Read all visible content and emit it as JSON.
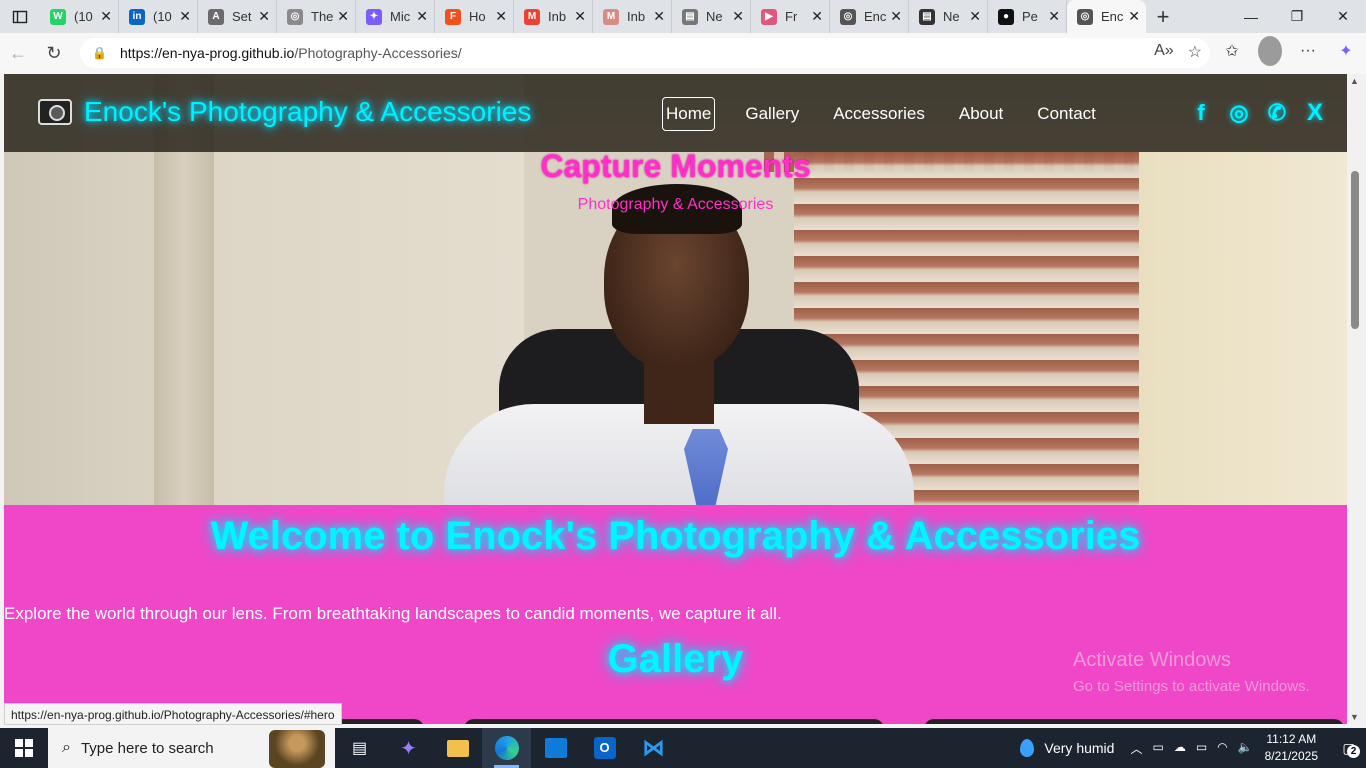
{
  "browser": {
    "tabs": [
      {
        "title": "(10",
        "icon": "whatsapp-icon",
        "color": "#25d366",
        "glyph": "W"
      },
      {
        "title": "(10",
        "icon": "linkedin-icon",
        "color": "#0a66c2",
        "glyph": "in"
      },
      {
        "title": "Set",
        "icon": "settings-icon",
        "color": "#6b6b6b",
        "glyph": "A"
      },
      {
        "title": "The",
        "icon": "globe-icon",
        "color": "#8a8a8a",
        "glyph": "◎"
      },
      {
        "title": "Mic",
        "icon": "copilot-icon",
        "color": "#7a5cff",
        "glyph": "✦"
      },
      {
        "title": "Ho",
        "icon": "figma-icon",
        "color": "#f24e1e",
        "glyph": "F"
      },
      {
        "title": "Inb",
        "icon": "gmail-icon",
        "color": "#ea4335",
        "glyph": "M"
      },
      {
        "title": "Inb",
        "icon": "gmail-icon",
        "color": "#d68b84",
        "glyph": "M"
      },
      {
        "title": "Ne",
        "icon": "news-icon",
        "color": "#777777",
        "glyph": "▤"
      },
      {
        "title": "Fr",
        "icon": "youtube-icon",
        "color": "#e0567d",
        "glyph": "▶"
      },
      {
        "title": "Enc",
        "icon": "globe-icon",
        "color": "#555555",
        "glyph": "◎"
      },
      {
        "title": "Ne",
        "icon": "news-icon",
        "color": "#333333",
        "glyph": "▤"
      },
      {
        "title": "Pe",
        "icon": "github-icon",
        "color": "#111111",
        "glyph": "●"
      },
      {
        "title": "Enc",
        "icon": "globe-icon",
        "color": "#555555",
        "glyph": "◎"
      }
    ],
    "url_host": "https://en-nya-prog.github.io",
    "url_path": "/Photography-Accessories/",
    "status_url": "https://en-nya-prog.github.io/Photography-Accessories/#hero"
  },
  "site": {
    "brand": "Enock's Photography & Accessories",
    "nav": [
      "Home",
      "Gallery",
      "Accessories",
      "About",
      "Contact"
    ],
    "social": [
      "f",
      "◎",
      "✆",
      "X"
    ],
    "hero_title": "Capture Moments",
    "hero_subtitle": "Photography & Accessories",
    "welcome_heading": "Welcome to Enock's Photography & Accessories",
    "intro": "Explore the world through our lens. From breathtaking landscapes to candid moments, we capture it all.",
    "gallery_heading": "Gallery"
  },
  "watermark": {
    "line1": "Activate Windows",
    "line2": "Go to Settings to activate Windows."
  },
  "taskbar": {
    "search_placeholder": "Type here to search",
    "weather": "Very humid",
    "time": "11:12 AM",
    "date": "8/21/2025",
    "notifications": "2"
  },
  "colors": {
    "accent_cyan": "#00f0ff",
    "hero_pink": "#ff2fc8",
    "page_pink": "#f046c8"
  }
}
